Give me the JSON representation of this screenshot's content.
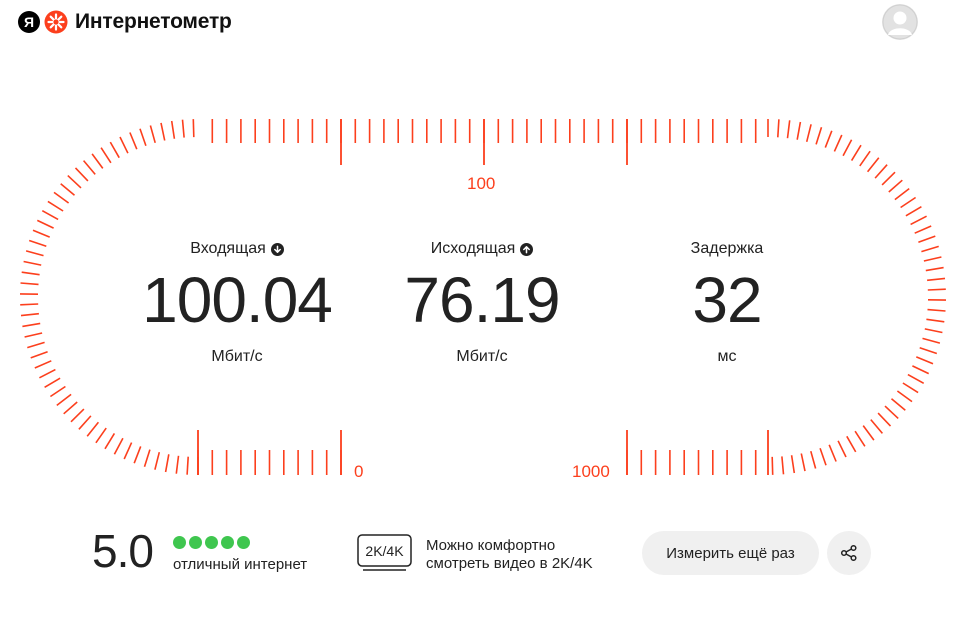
{
  "header": {
    "brand_letter": "Я",
    "service_title": "Интернетометр"
  },
  "scale": {
    "labels": {
      "zero": "0",
      "hundred": "100",
      "thousand": "1000"
    },
    "accent_color": "#fc3f1d"
  },
  "metrics": {
    "download": {
      "title": "Входящая",
      "value": "100.04",
      "unit": "Мбит/с",
      "icon": "arrow-down-icon"
    },
    "upload": {
      "title": "Исходящая",
      "value": "76.19",
      "unit": "Мбит/с",
      "icon": "arrow-up-icon"
    },
    "latency": {
      "title": "Задержка",
      "value": "32",
      "unit": "мс"
    }
  },
  "rating": {
    "score": "5.0",
    "stars": 5,
    "star_color": "#3fc64f",
    "text": "отличный интернет"
  },
  "quality": {
    "badge": "2K/4K",
    "line1": "Можно комфортно",
    "line2": "смотреть видео в 2K/4K"
  },
  "actions": {
    "remeasure_label": "Измерить ещё раз",
    "share_icon": "share-icon"
  }
}
